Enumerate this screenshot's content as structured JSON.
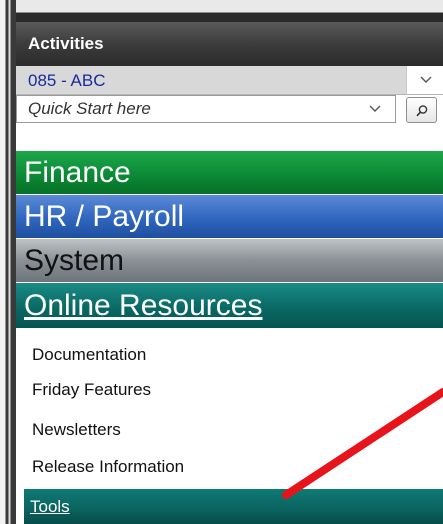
{
  "panel": {
    "title": "Activities"
  },
  "district_select": {
    "value": "085 - ABC"
  },
  "quick_start": {
    "placeholder": "Quick Start here"
  },
  "categories": {
    "finance": "Finance",
    "hr_payroll": "HR / Payroll",
    "system": "System",
    "online_resources": "Online Resources"
  },
  "online_resources_items": {
    "documentation": "Documentation",
    "friday_features": "Friday Features",
    "newsletters": "Newsletters",
    "release_information": "Release Information",
    "tools": "Tools"
  },
  "icons": {
    "dropdown": "chevron-down-icon",
    "search": "search-icon"
  },
  "colors": {
    "finance": "#0c8a36",
    "hr_payroll": "#2f66bf",
    "system": "#8a9095",
    "online_resources": "#0a6965",
    "annotation_arrow": "#e8141b"
  }
}
